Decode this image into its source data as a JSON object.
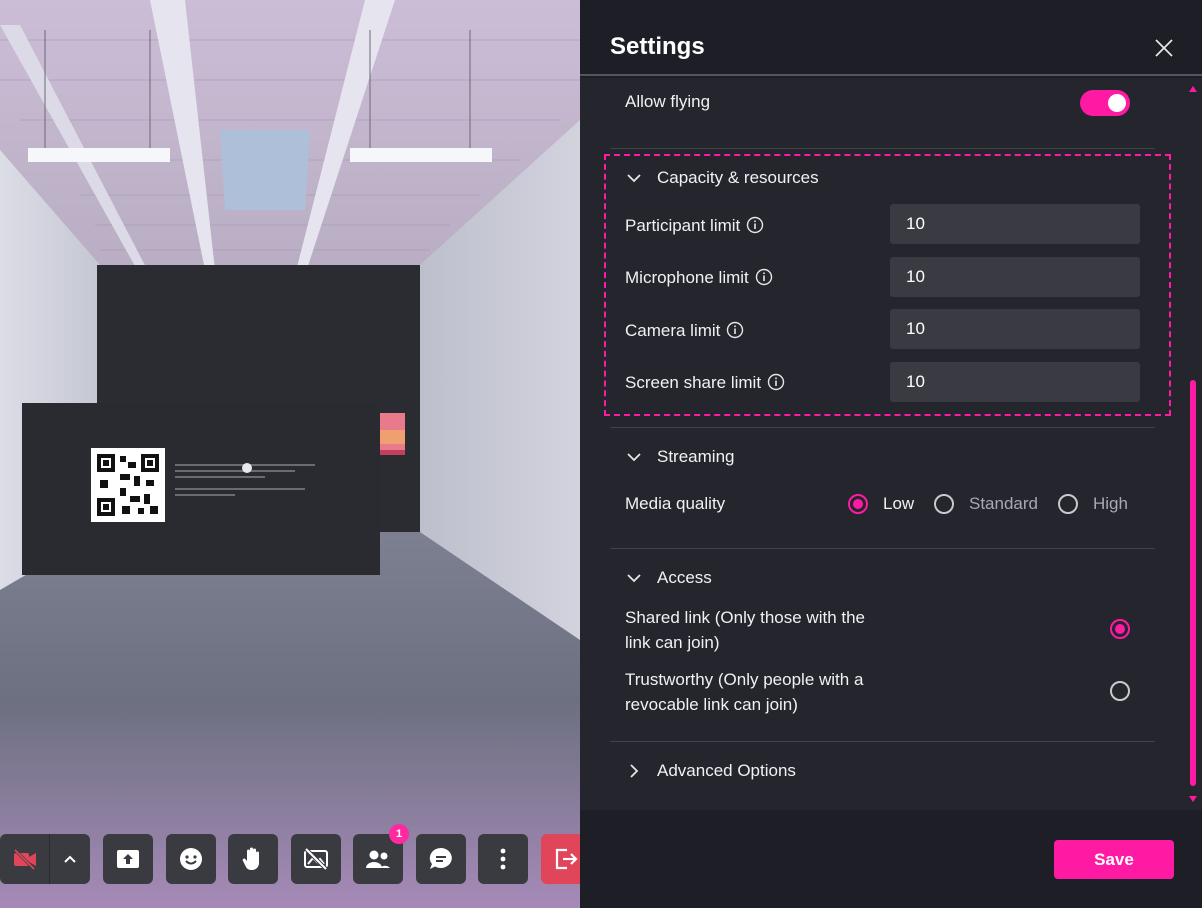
{
  "scene": {
    "toolbar": {
      "people_badge_count": "1"
    }
  },
  "settings": {
    "title": "Settings",
    "allow_flying": {
      "label": "Allow flying",
      "enabled": true
    },
    "capacity": {
      "heading": "Capacity & resources",
      "fields": [
        {
          "label": "Participant limit",
          "value": "10"
        },
        {
          "label": "Microphone limit",
          "value": "10"
        },
        {
          "label": "Camera limit",
          "value": "10"
        },
        {
          "label": "Screen share limit",
          "value": "10"
        }
      ]
    },
    "streaming": {
      "heading": "Streaming",
      "media_quality_label": "Media quality",
      "options": [
        "Low",
        "Standard",
        "High"
      ],
      "selected": "Low"
    },
    "access": {
      "heading": "Access",
      "options": [
        {
          "label": "Shared link (Only those with the link can join)",
          "selected": true
        },
        {
          "label": "Trustworthy (Only people with a revocable link can join)",
          "selected": false
        }
      ]
    },
    "advanced": {
      "heading": "Advanced Options"
    },
    "save_label": "Save"
  },
  "colors": {
    "accent": "#ff1aa3",
    "panel_bg": "#24252d",
    "input_bg": "#393a42",
    "camera_off": "#e0455a",
    "leave": "#e0455a"
  }
}
